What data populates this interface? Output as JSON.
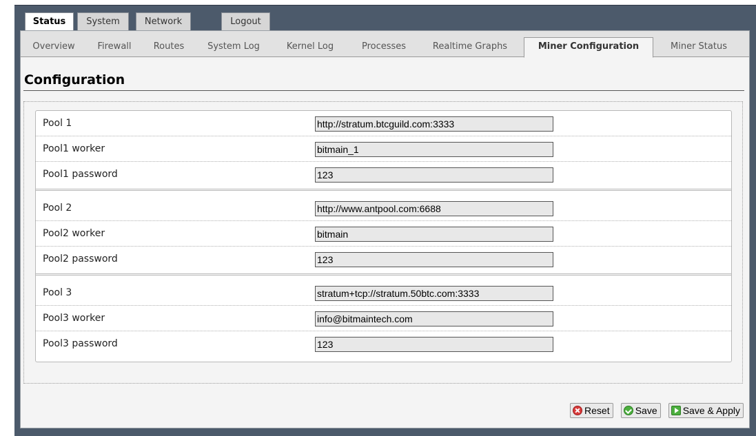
{
  "top_tabs": [
    {
      "label": "Status",
      "active": true
    },
    {
      "label": "System",
      "active": false
    },
    {
      "label": "Network",
      "active": false
    },
    {
      "label": "Logout",
      "active": false
    }
  ],
  "sub_tabs": [
    {
      "label": "Overview",
      "active": false
    },
    {
      "label": "Firewall",
      "active": false
    },
    {
      "label": "Routes",
      "active": false
    },
    {
      "label": "System Log",
      "active": false
    },
    {
      "label": "Kernel Log",
      "active": false
    },
    {
      "label": "Processes",
      "active": false
    },
    {
      "label": "Realtime Graphs",
      "active": false
    },
    {
      "label": "Miner Configuration",
      "active": true
    },
    {
      "label": "Miner Status",
      "active": false
    }
  ],
  "page_title": "Configuration",
  "rows": [
    {
      "label": "Pool 1",
      "value": "http://stratum.btcguild.com:3333"
    },
    {
      "label": "Pool1 worker",
      "value": "bitmain_1"
    },
    {
      "label": "Pool1 password",
      "value": "123"
    },
    {
      "label": "Pool 2",
      "value": "http://www.antpool.com:6688"
    },
    {
      "label": "Pool2 worker",
      "value": "bitmain"
    },
    {
      "label": "Pool2 password",
      "value": "123"
    },
    {
      "label": "Pool 3",
      "value": "stratum+tcp://stratum.50btc.com:3333"
    },
    {
      "label": "Pool3 worker",
      "value": "info@bitmaintech.com"
    },
    {
      "label": "Pool3 password",
      "value": "123"
    }
  ],
  "actions": {
    "reset_label": "Reset",
    "save_label": "Save",
    "save_apply_label": "Save & Apply"
  },
  "colors": {
    "frame": "#4c5a6b",
    "page_bg": "#f4f4f4",
    "reset_icon": "#d83a3a",
    "save_icon": "#4caf3e"
  },
  "icons": {
    "reset": "reset-icon",
    "save": "save-icon",
    "save_apply": "save-apply-icon"
  }
}
